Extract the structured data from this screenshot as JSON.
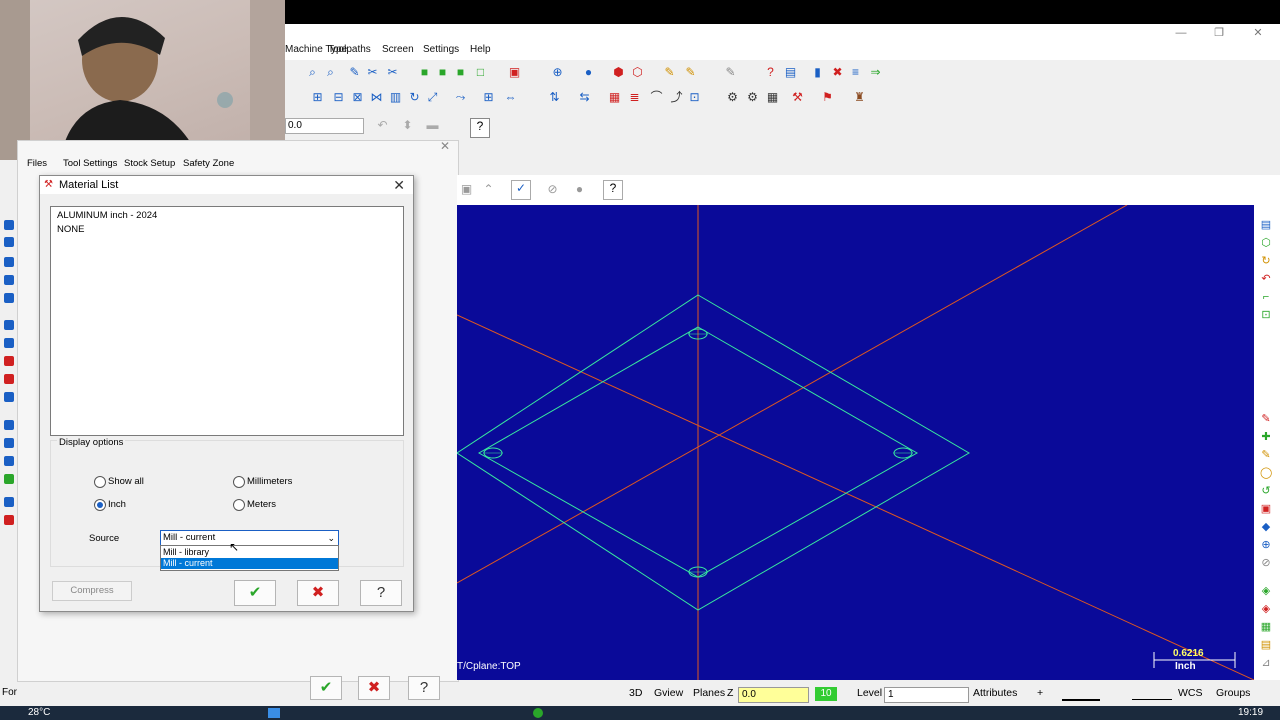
{
  "menu": [
    "Machine Type",
    "Toolpaths",
    "Screen",
    "Settings",
    "Help"
  ],
  "toolbar": {
    "coord_value": "0.0"
  },
  "manager_tabs": [
    "Files",
    "Tool Settings",
    "Stock Setup",
    "Safety Zone"
  ],
  "dialog": {
    "title": "Material List",
    "materials": [
      "ALUMINUM inch - 2024",
      "NONE"
    ],
    "display_options_label": "Display options",
    "radios": {
      "show_all": "Show all",
      "millimeters": "Millimeters",
      "inch": "Inch",
      "meters": "Meters"
    },
    "selected_radio": "inch",
    "source_label": "Source",
    "source_value": "Mill - current",
    "source_options": [
      "Mill - library",
      "Mill - current"
    ],
    "compress_label": "Compress"
  },
  "viewport": {
    "view_label": "T/Cplane:TOP",
    "scale_value": "0.6216",
    "scale_unit": "Inch",
    "background_color": "#0a0a99",
    "geometry_color": "#38e8a0",
    "axis_color": "#e0581f"
  },
  "statusbar": {
    "mode": "3D",
    "gview": "Gview",
    "planes": "Planes",
    "z_label": "Z",
    "z_value": "0.0",
    "level_box": "10",
    "level_label": "Level",
    "level_value": "1",
    "attributes": "Attributes",
    "wcs": "WCS",
    "groups": "Groups",
    "left_text": "For"
  },
  "taskbar": {
    "weather": "28°C",
    "time": "19:19"
  }
}
